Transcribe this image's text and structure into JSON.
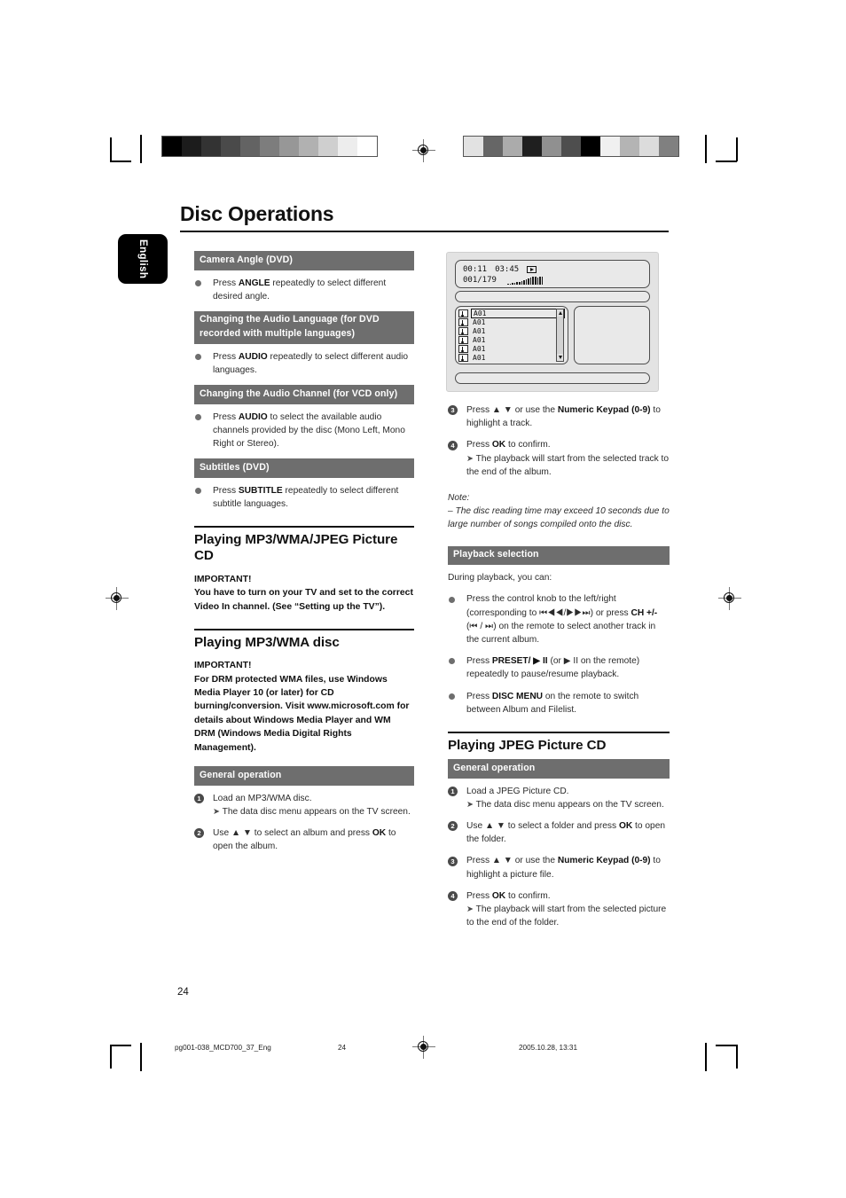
{
  "page": {
    "title": "Disc Operations",
    "language_tab": "English",
    "page_number": "24"
  },
  "footer": {
    "file": "pg001-038_MCD700_37_Eng",
    "page": "24",
    "timestamp": "2005.10.28, 13:31"
  },
  "colorbars": {
    "left": [
      "#000000",
      "#1c1c1c",
      "#333333",
      "#4a4a4a",
      "#636363",
      "#7d7d7d",
      "#979797",
      "#b1b1b1",
      "#cfcfcf",
      "#ededed",
      "#ffffff"
    ],
    "right": [
      "#e2e2e2",
      "#666666",
      "#ababab",
      "#1f1f1f",
      "#909090",
      "#4e4e4e",
      "#000000",
      "#f0f0f0",
      "#b4b4b4",
      "#dcdcdc",
      "#808080"
    ]
  },
  "left_column": {
    "camera_angle": {
      "heading": "Camera Angle (DVD)",
      "bullets": [
        {
          "pre": "Press ",
          "strong": "ANGLE",
          "post": " repeatedly to select different desired angle."
        }
      ]
    },
    "audio_language": {
      "heading": "Changing the Audio Language (for DVD recorded with multiple languages)",
      "bullets": [
        {
          "pre": "Press ",
          "strong": "AUDIO",
          "post": " repeatedly to select different audio languages."
        }
      ]
    },
    "audio_channel": {
      "heading": "Changing the Audio Channel  (for VCD only)",
      "bullets": [
        {
          "pre": "Press ",
          "strong": "AUDIO",
          "post": " to select the available audio channels provided by the disc (Mono Left, Mono Right or Stereo)."
        }
      ]
    },
    "subtitles": {
      "heading": "Subtitles (DVD)",
      "bullets": [
        {
          "pre": "Press ",
          "strong": "SUBTITLE",
          "post": " repeatedly to select different subtitle languages."
        }
      ]
    },
    "mp3_wma_jpeg": {
      "heading": "Playing MP3/WMA/JPEG Picture CD",
      "important_label": "IMPORTANT!",
      "important_text": "You have to turn on your TV and set to the correct Video In channel. (See “Setting up the TV”)."
    },
    "mp3_wma_disc": {
      "heading": "Playing MP3/WMA disc",
      "important_label": "IMPORTANT!",
      "important_text": "For DRM protected WMA files, use Windows Media Player 10 (or later) for CD burning/conversion. Visit www.microsoft.com for details about Windows Media Player and WM DRM (Windows Media Digital Rights Management)."
    },
    "general_operation": {
      "heading": "General operation",
      "steps": [
        {
          "num": "1",
          "text": "Load an MP3/WMA disc.",
          "arrow": "The data disc menu appears on the TV screen."
        },
        {
          "num": "2",
          "pre": "Use ▲  ▼  to select an album and press ",
          "strong": "OK",
          "post": " to open the album."
        }
      ]
    }
  },
  "right_column": {
    "tv_screen": {
      "time_elapsed": "00:11",
      "time_total": "03:45",
      "track_counter": "001/179",
      "play_icon": "play-icon",
      "tracks": [
        {
          "label": "A01",
          "selected": true
        },
        {
          "label": "A01",
          "selected": false
        },
        {
          "label": "A01",
          "selected": false
        },
        {
          "label": "A01",
          "selected": false
        },
        {
          "label": "A01",
          "selected": false
        },
        {
          "label": "A01",
          "selected": false
        }
      ]
    },
    "steps": [
      {
        "num": "3",
        "pre": "Press ▲  ▼  or use the ",
        "strong": "Numeric Keypad (0-9)",
        "post": " to highlight a track."
      },
      {
        "num": "4",
        "pre": "Press ",
        "strong": "OK",
        "post": " to confirm.",
        "arrow": "The playback will start from the selected track to the end of the album."
      }
    ],
    "note": {
      "label": "Note:",
      "text": "–  The disc reading time may exceed 10 seconds due to large number of songs compiled onto the disc."
    },
    "playback_selection": {
      "heading": "Playback selection",
      "intro": "During playback, you can:",
      "bullets": [
        {
          "pre": "Press the control knob to the left/right (corresponding to ⏮◀◀/▶▶⏭) or press ",
          "strong": "CH +/-",
          "post": " (⏮ / ⏭)  on the remote to select another track in the current album."
        },
        {
          "pre": "Press ",
          "strong": "PRESET/ ▶ II",
          "post": "  (or  ▶ II  on the remote) repeatedly to pause/resume playback."
        },
        {
          "pre": "Press ",
          "strong": "DISC MENU",
          "post": " on the remote to switch between Album and Filelist."
        }
      ]
    },
    "jpeg_cd": {
      "heading": "Playing JPEG Picture CD",
      "general_heading": "General operation",
      "steps": [
        {
          "num": "1",
          "text": "Load a JPEG Picture CD.",
          "arrow": "The data disc menu appears on the TV screen."
        },
        {
          "num": "2",
          "pre": "Use ▲  ▼  to select a folder and press ",
          "strong": "OK",
          "post": " to open the folder."
        },
        {
          "num": "3",
          "pre": "Press ▲  ▼  or use the ",
          "strong": "Numeric Keypad (0-9)",
          "post": " to highlight a picture file."
        },
        {
          "num": "4",
          "pre": "Press ",
          "strong": "OK",
          "post": " to confirm.",
          "arrow": "The playback will start from the selected picture to the end of the folder."
        }
      ]
    }
  }
}
